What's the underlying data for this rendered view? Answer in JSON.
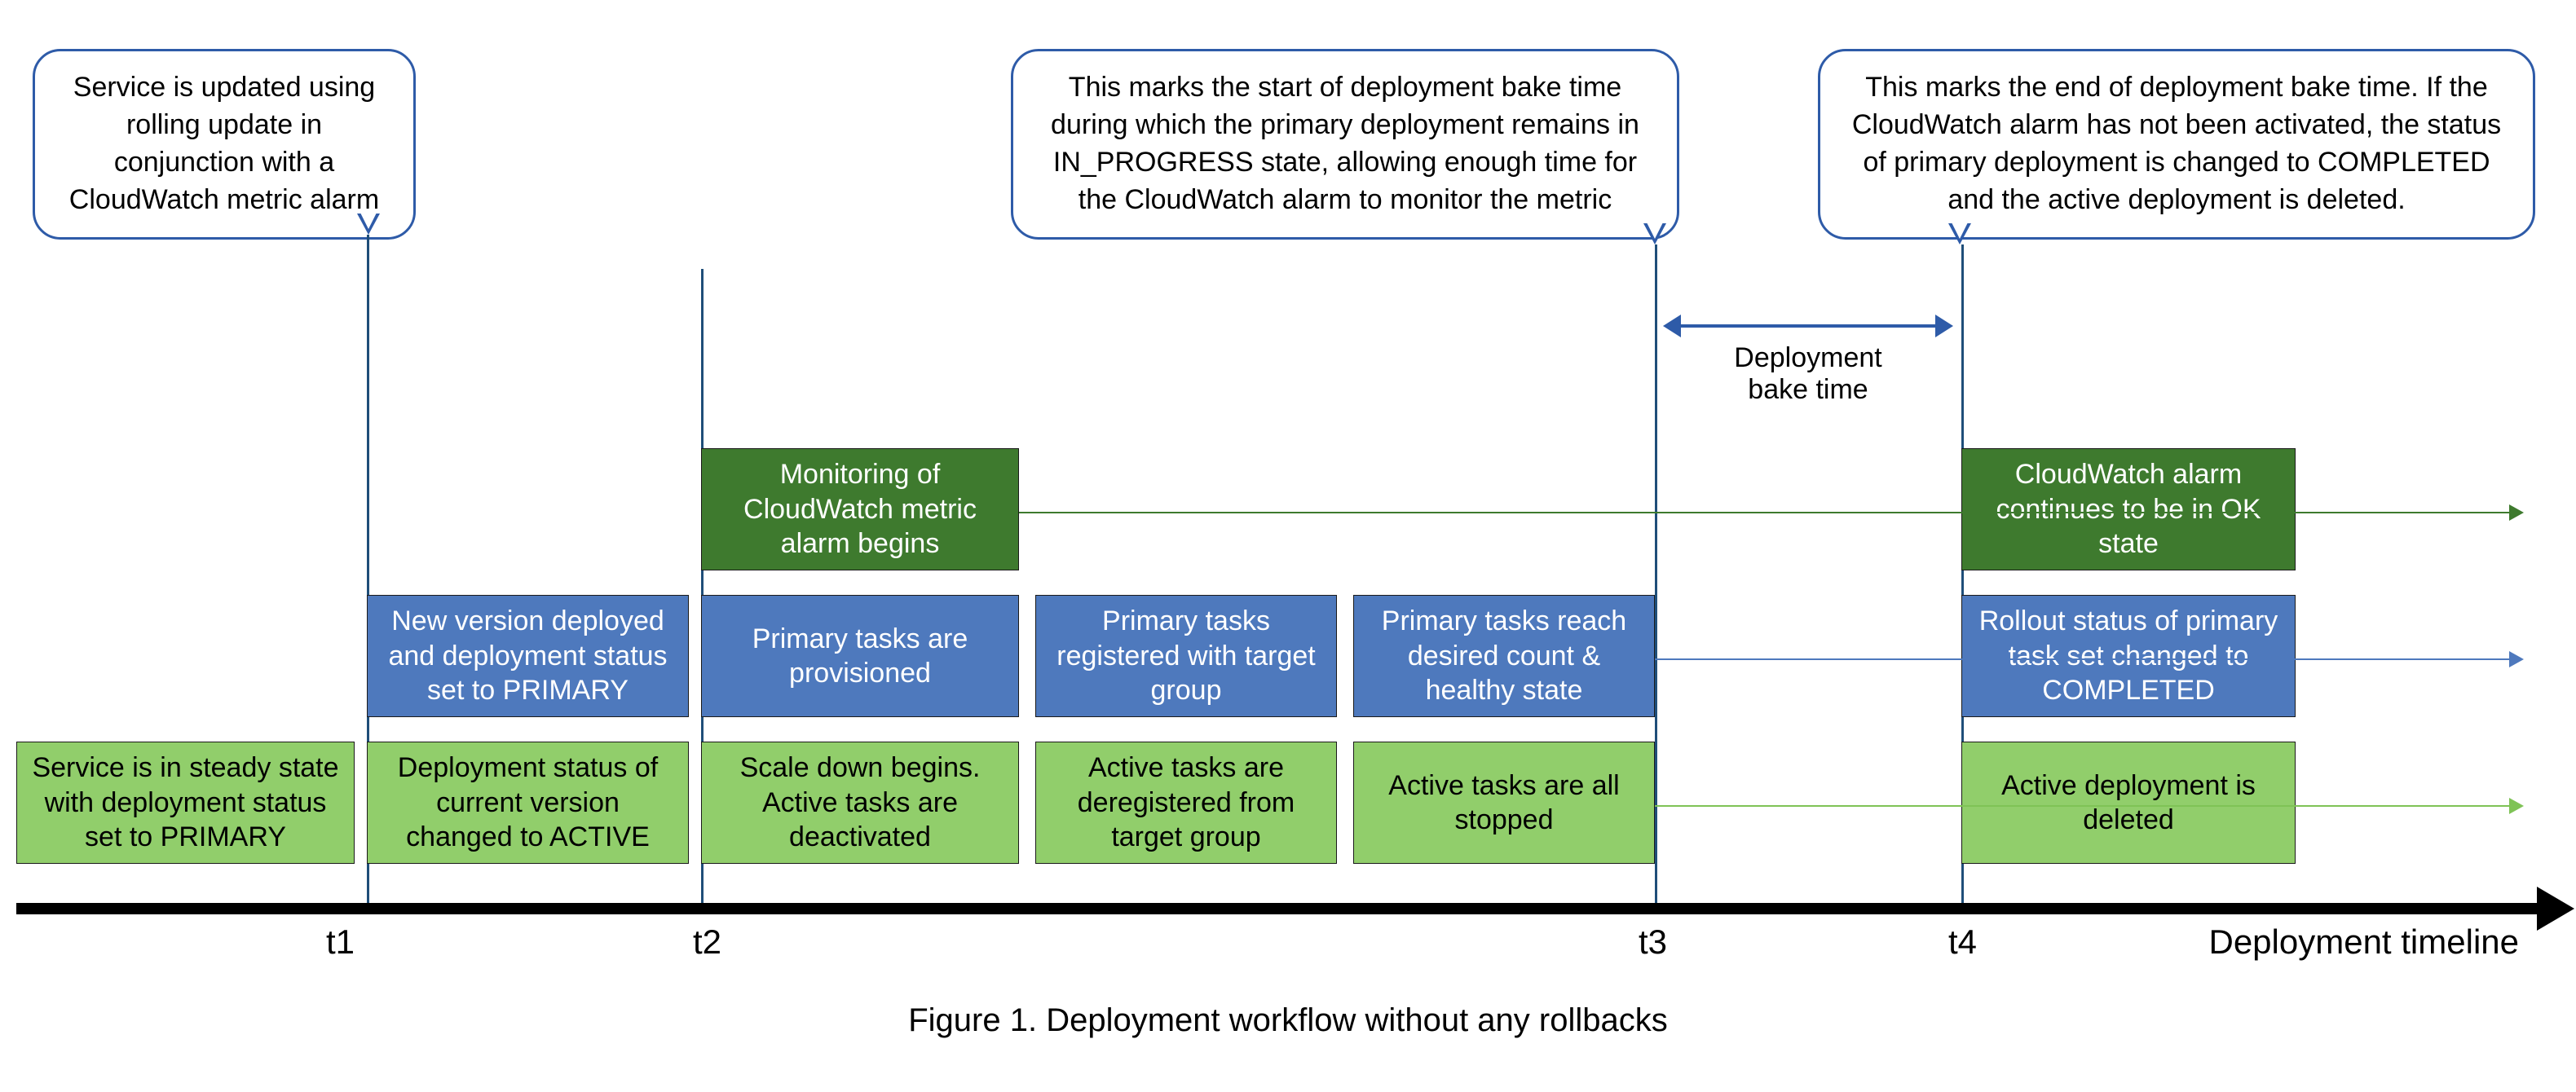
{
  "caption": "Figure 1. Deployment workflow without any rollbacks",
  "axis_label": "Deployment timeline",
  "ticks": {
    "t1": "t1",
    "t2": "t2",
    "t3": "t3",
    "t4": "t4"
  },
  "bake_time_label": "Deployment\nbake time",
  "callouts": {
    "c1": "Service is updated using rolling update in conjunction with a CloudWatch metric alarm",
    "c2": "This marks the start of deployment bake time during which the primary deployment remains in IN_PROGRESS state, allowing enough time for the CloudWatch alarm to monitor the metric",
    "c3": "This marks the end of deployment bake time. If the CloudWatch alarm has not been activated, the status of primary deployment is changed to COMPLETED and the active deployment is deleted."
  },
  "lane_dark": {
    "b1": "Monitoring of CloudWatch metric alarm begins",
    "b2": "CloudWatch alarm continues to be in OK state"
  },
  "lane_blue": {
    "b1": "New version deployed and deployment status set to PRIMARY",
    "b2": "Primary tasks are provisioned",
    "b3": "Primary tasks registered with target group",
    "b4": "Primary tasks reach desired count & healthy state",
    "b5": "Rollout status of primary task set changed to COMPLETED"
  },
  "lane_light": {
    "b0": "Service is in steady state with deployment status set to PRIMARY",
    "b1": "Deployment status of current version changed to ACTIVE",
    "b2": "Scale down begins. Active tasks are deactivated",
    "b3": "Active tasks are deregistered from target group",
    "b4": "Active tasks are all stopped",
    "b5": "Active deployment is deleted"
  },
  "colors": {
    "green_dark": "#3E7A2E",
    "green_light": "#91CE6B",
    "blue": "#4E79BD",
    "outline": "#2E5BA8"
  },
  "chart_data": {
    "type": "timeline",
    "time_markers": [
      "t1",
      "t2",
      "t3",
      "t4"
    ],
    "bake_time_span": [
      "t3",
      "t4"
    ],
    "lanes": [
      {
        "name": "monitoring",
        "color": "green_dark",
        "events": [
          {
            "at": "t2",
            "label": "Monitoring of CloudWatch metric alarm begins"
          },
          {
            "at": "t4",
            "label": "CloudWatch alarm continues to be in OK state"
          }
        ]
      },
      {
        "name": "primary",
        "color": "blue",
        "events": [
          {
            "at": "t1",
            "label": "New version deployed and deployment status set to PRIMARY"
          },
          {
            "at": "t2",
            "label": "Primary tasks are provisioned"
          },
          {
            "between": [
              "t2",
              "t3"
            ],
            "label": "Primary tasks registered with target group"
          },
          {
            "before": "t3",
            "label": "Primary tasks reach desired count & healthy state"
          },
          {
            "at": "t4",
            "label": "Rollout status of primary task set changed to COMPLETED"
          }
        ]
      },
      {
        "name": "active",
        "color": "green_light",
        "events": [
          {
            "before": "t1",
            "label": "Service is in steady state with deployment status set to PRIMARY"
          },
          {
            "at": "t1",
            "label": "Deployment status of current version changed to ACTIVE"
          },
          {
            "at": "t2",
            "label": "Scale down begins. Active tasks are deactivated"
          },
          {
            "between": [
              "t2",
              "t3"
            ],
            "label": "Active tasks are deregistered from target group"
          },
          {
            "before": "t3",
            "label": "Active tasks are all stopped"
          },
          {
            "at": "t4",
            "label": "Active deployment is deleted"
          }
        ]
      }
    ],
    "callouts": [
      {
        "at": "t1",
        "text": "Service is updated using rolling update in conjunction with a CloudWatch metric alarm"
      },
      {
        "at": "t3",
        "text": "This marks the start of deployment bake time during which the primary deployment remains in IN_PROGRESS state, allowing enough time for the CloudWatch alarm to monitor the metric"
      },
      {
        "at": "t4",
        "text": "This marks the end of deployment bake time. If the CloudWatch alarm has not been activated, the status of primary deployment is changed to COMPLETED and the active deployment is deleted."
      }
    ]
  }
}
